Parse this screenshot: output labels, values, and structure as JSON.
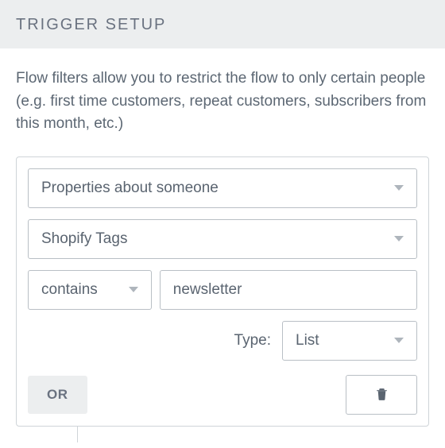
{
  "header": {
    "title": "TRIGGER SETUP"
  },
  "description": "Flow filters allow you to restrict the flow to only certain people (e.g. first time customers, repeat customers, subscribers from this month, etc.)",
  "filter": {
    "property_selector": "Properties about someone",
    "attribute_selector": "Shopify Tags",
    "operator_selector": "contains",
    "value_input": "newsletter",
    "type_label": "Type:",
    "type_selector": "List",
    "or_button": "OR"
  }
}
